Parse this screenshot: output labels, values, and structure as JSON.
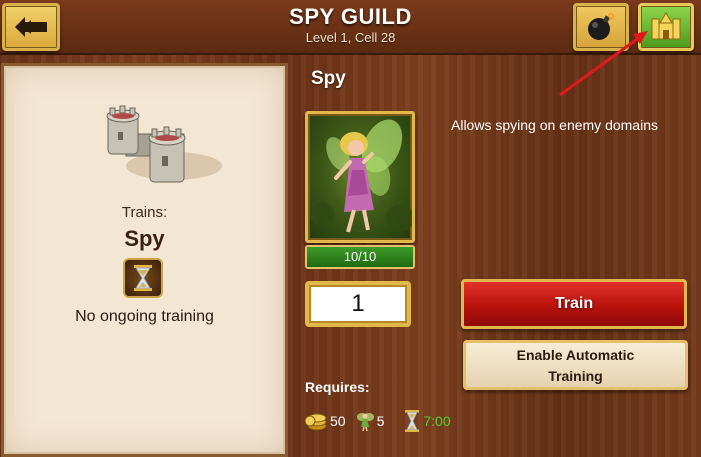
{
  "header": {
    "title": "SPY GUILD",
    "subtitle": "Level 1, Cell 28",
    "back_icon": "back-arrow-icon",
    "bomb_icon": "bomb-icon",
    "home_icon": "castle-home-icon"
  },
  "left_panel": {
    "building_icon": "spy-guild-building-icon",
    "trains_label": "Trains:",
    "unit_name": "Spy",
    "status_icon": "hourglass-icon",
    "status_text": "No ongoing training"
  },
  "unit": {
    "name": "Spy",
    "portrait_icon": "fairy-spy-portrait",
    "count_text": "10/10",
    "count_fraction": 1.0,
    "quantity": "1",
    "description": "Allows spying on enemy domains"
  },
  "buttons": {
    "train_label": "Train",
    "auto_line1": "Enable Automatic",
    "auto_line2": "Training"
  },
  "requires": {
    "label": "Requires:",
    "gold": "50",
    "population": "5",
    "time": "7:00"
  },
  "colors": {
    "train_button": "#c81a12",
    "home_button": "#6ab82e",
    "time_text": "#4ed02a",
    "annotation_arrow": "#e01a1a"
  }
}
